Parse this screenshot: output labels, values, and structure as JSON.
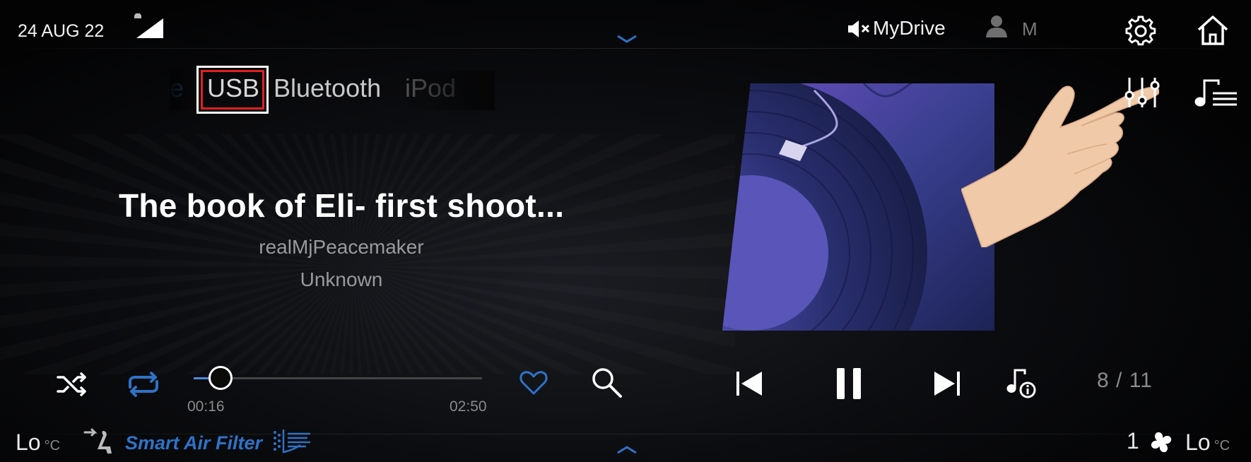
{
  "status_bar": {
    "date": "24 AUG 22",
    "profile_label": "MyDrive",
    "user_initial": "M"
  },
  "source_tabs": {
    "prev_partial": "e",
    "usb": "USB",
    "bluetooth": "Bluetooth",
    "ipod": "iPod",
    "selected": "USB"
  },
  "now_playing": {
    "title": "The book of Eli- first shoot...",
    "artist": "realMjPeacemaker",
    "album": "Unknown"
  },
  "playback": {
    "elapsed": "00:16",
    "total": "02:50",
    "progress": 0.094,
    "track_counter": "8 / 11"
  },
  "climate": {
    "left_temp": "Lo",
    "left_unit": "°C",
    "smart_air_label": "Smart Air Filter",
    "fan_level": "1",
    "right_temp": "Lo",
    "right_unit": "°C"
  },
  "icons": {
    "signal": "signal-icon",
    "mute": "speaker-mute-icon",
    "user": "user-icon",
    "settings": "gear-icon",
    "home": "home-icon",
    "equalizer": "equalizer-icon",
    "playlist": "playlist-icon",
    "shuffle": "shuffle-icon",
    "repeat": "repeat-icon",
    "favorite": "heart-icon",
    "search": "search-icon",
    "previous": "skip-previous-icon",
    "pause": "pause-icon",
    "next": "skip-next-icon",
    "track_info": "track-info-icon",
    "seat": "seat-icon",
    "airflow": "airflow-icon",
    "fan": "fan-icon"
  },
  "colors": {
    "accent_blue": "#2f72c7",
    "progress_blue": "#4a8be0",
    "highlight_red": "#e02020",
    "background": "#030304"
  }
}
